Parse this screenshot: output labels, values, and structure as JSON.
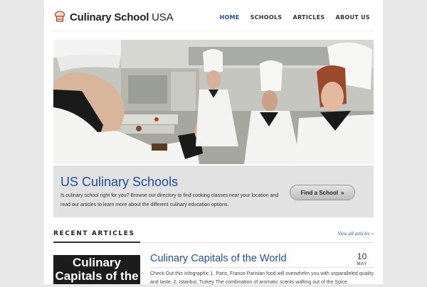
{
  "site": {
    "logo_bold": "Culinary School",
    "logo_light": "USA"
  },
  "nav": [
    {
      "label": "HOME",
      "active": true
    },
    {
      "label": "SCHOOLS",
      "active": false
    },
    {
      "label": "ARTICLES",
      "active": false
    },
    {
      "label": "ABOUT US",
      "active": false
    }
  ],
  "intro": {
    "title": "US Culinary Schools",
    "text": "Is culinary school right for you? Browse our directory to find cooking classes near your location and read our articles to learn more about the different culinary education options.",
    "button_label": "Find a School",
    "button_arrow": "»"
  },
  "recent": {
    "heading": "RECENT ARTICLES",
    "view_all": "View all articles »",
    "article": {
      "thumb_text": "Culinary Capitals of the World",
      "title": "Culinary Capitals of the World",
      "day": "10",
      "month": "MAY",
      "excerpt": "Check Out this Infographic 1. Paris, France Parisian food will overwhelm you with unparalleled quality and taste. 2. Istanbul, Turkey The combination of aromatic scents wafting out of the Spice"
    }
  },
  "colors": {
    "accent": "#1f4e9c",
    "background": "#e8e8e8"
  }
}
